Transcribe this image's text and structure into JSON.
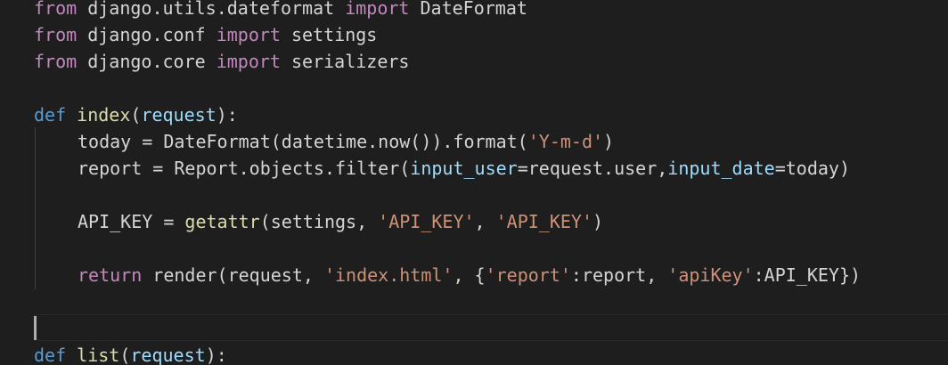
{
  "editor": {
    "imports": [
      {
        "from": "from",
        "module": " django.utils.dateformat ",
        "import": "import",
        "name": " DateFormat"
      },
      {
        "from": "from",
        "module": " django.conf ",
        "import": "import",
        "name": " settings"
      },
      {
        "from": "from",
        "module": " django.core ",
        "import": "import",
        "name": " serializers"
      }
    ],
    "index_def": {
      "def": "def",
      "name": "index",
      "open": "(",
      "param": "request",
      "close": "):"
    },
    "today_line": {
      "a": "today = DateFormat(datetime.now()).format(",
      "str": "'Y-m-d'",
      "b": ")"
    },
    "report_line": {
      "a": "report = Report.objects.filter(",
      "kw1": "input_user",
      "b": "=request.user,",
      "kw2": "input_date",
      "c": "=today)"
    },
    "apikey_line": {
      "a": "API_KEY = ",
      "fn": "getattr",
      "b": "(settings, ",
      "s1": "'API_KEY'",
      "c": ", ",
      "s2": "'API_KEY'",
      "d": ")"
    },
    "return_line": {
      "kw": "return",
      "a": " render(request, ",
      "s1": "'index.html'",
      "b": ", {",
      "s2": "'report'",
      "c": ":report, ",
      "s3": "'apiKey'",
      "d": ":API_KEY})"
    },
    "list_def": {
      "def": "def",
      "name": "list",
      "open": "(",
      "param": "request",
      "close": "):"
    }
  }
}
